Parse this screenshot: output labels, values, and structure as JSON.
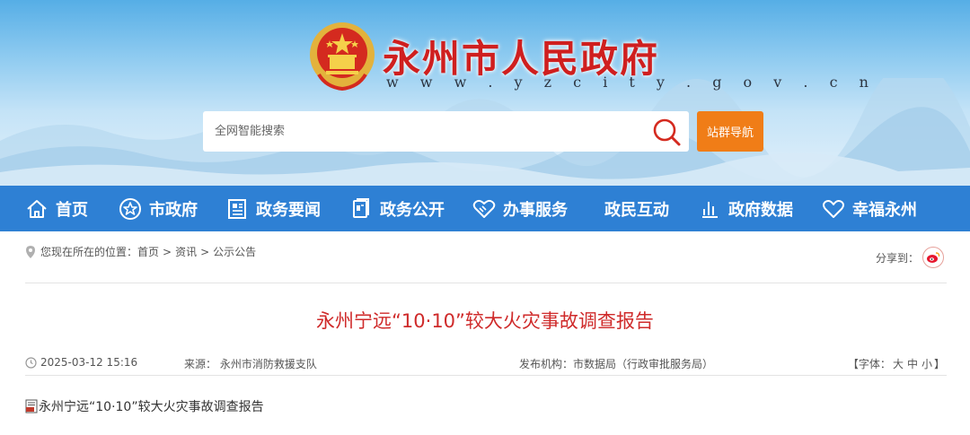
{
  "header": {
    "site_title": "永州市人民政府",
    "site_url": "w w w . y z c i t y . g o v . c n",
    "search_placeholder": "全网智能搜索",
    "nav_guide_label": "站群导航"
  },
  "nav": {
    "items": [
      {
        "label": "首页",
        "icon": "home-icon"
      },
      {
        "label": "市政府",
        "icon": "star-badge-icon"
      },
      {
        "label": "政务要闻",
        "icon": "newspaper-icon"
      },
      {
        "label": "政务公开",
        "icon": "document-icon"
      },
      {
        "label": "办事服务",
        "icon": "handshake-icon"
      },
      {
        "label": "政民互动",
        "icon": ""
      },
      {
        "label": "政府数据",
        "icon": "bar-chart-icon"
      },
      {
        "label": "幸福永州",
        "icon": "heart-icon"
      }
    ]
  },
  "breadcrumb": {
    "prefix": "您现在所在的位置：",
    "items": [
      "首页",
      "资讯",
      "公示公告"
    ],
    "separator": ">"
  },
  "share": {
    "label": "分享到："
  },
  "article": {
    "title": "永州宁远“10·10”较大火灾事故调查报告",
    "datetime": "2025-03-12 15:16",
    "source": "来源： 永州市消防救援支队",
    "publisher": "发布机构：市数据局（行政审批服务局）",
    "font_size": {
      "prefix": "【字体：",
      "large": "大",
      "medium": "中",
      "small": "小",
      "suffix": "】"
    },
    "attachment": "永州宁远“10·10”较大火灾事故调查报告"
  },
  "colors": {
    "nav_bg": "#2e80d4",
    "title_red": "#cf1f1f",
    "nav_guide_orange": "#f07d17"
  }
}
